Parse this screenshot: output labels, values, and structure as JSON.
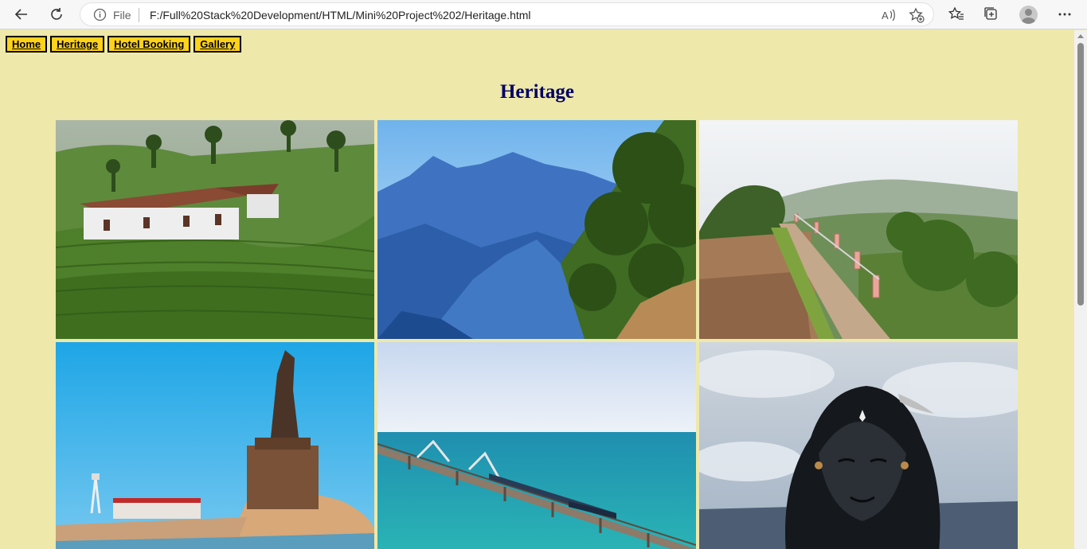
{
  "browser": {
    "address_scheme": "File",
    "url": "F:/Full%20Stack%20Development/HTML/Mini%20Project%202/Heritage.html",
    "icons": [
      "back-icon",
      "refresh-icon",
      "info-icon",
      "read-aloud-icon",
      "add-favorite-icon",
      "favorites-icon",
      "collections-icon",
      "profile-avatar",
      "more-icon"
    ]
  },
  "nav": {
    "items": [
      {
        "label": "Home"
      },
      {
        "label": "Heritage"
      },
      {
        "label": "Hotel Booking"
      },
      {
        "label": "Gallery"
      }
    ]
  },
  "page": {
    "title": "Heritage",
    "background": "#eee8aa",
    "nav_color": "#ffd21a",
    "title_color": "#000066"
  },
  "gallery": {
    "images": [
      {
        "name": "tea-estate-photo"
      },
      {
        "name": "blue-mountains-photo"
      },
      {
        "name": "hill-walkway-photo"
      },
      {
        "name": "rock-memorial-statue-photo"
      },
      {
        "name": "sea-bridge-train-photo"
      },
      {
        "name": "black-statue-face-photo"
      }
    ]
  }
}
